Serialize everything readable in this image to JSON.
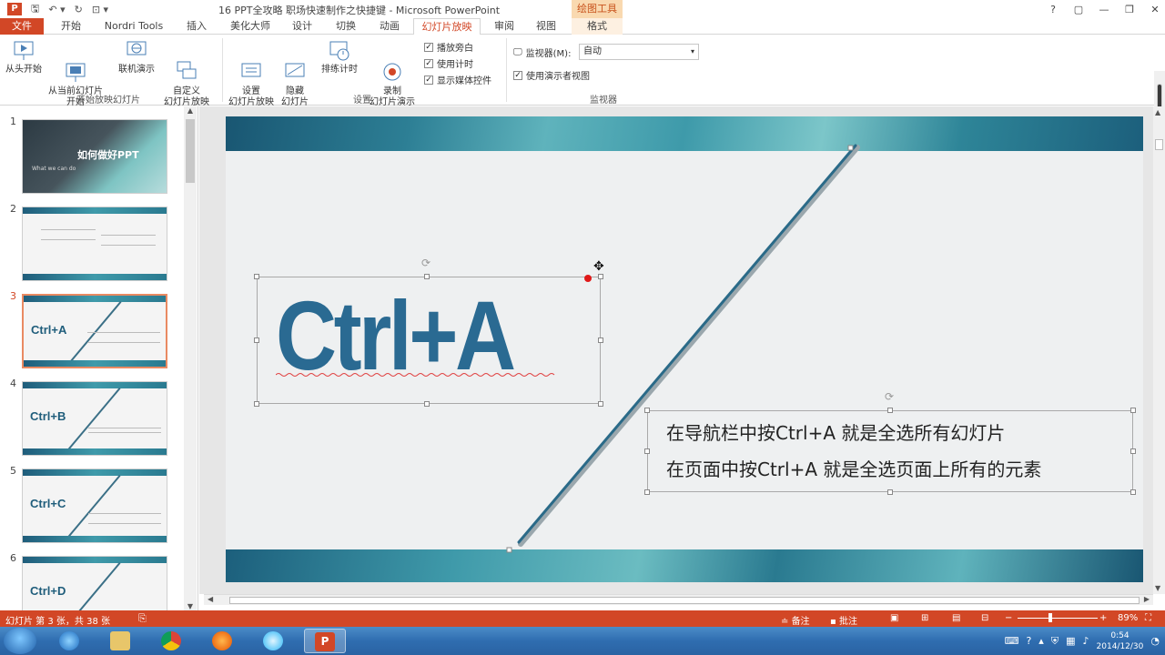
{
  "window": {
    "title": "16 PPT全攻略 职场快速制作之快捷键 - Microsoft PowerPoint",
    "contextual_tab_group": "绘图工具",
    "controls": [
      "?",
      "▢",
      "—",
      "❐",
      "✕"
    ]
  },
  "tabs": [
    {
      "label": "文件"
    },
    {
      "label": "开始"
    },
    {
      "label": "Nordri Tools"
    },
    {
      "label": "插入"
    },
    {
      "label": "美化大师"
    },
    {
      "label": "设计"
    },
    {
      "label": "切换"
    },
    {
      "label": "动画"
    },
    {
      "label": "幻灯片放映"
    },
    {
      "label": "审阅"
    },
    {
      "label": "视图"
    },
    {
      "label": "格式"
    }
  ],
  "ribbon": {
    "group1": {
      "label": "开始放映幻灯片",
      "buttons": [
        "从头开始",
        "从当前幻灯片\n开始",
        "联机演示",
        "自定义\n幻灯片放映"
      ]
    },
    "group2": {
      "label": "设置",
      "buttons": [
        "设置\n幻灯片放映",
        "隐藏\n幻灯片",
        "排练计时",
        "录制\n幻灯片演示"
      ],
      "checkboxes": [
        "播放旁白",
        "使用计时",
        "显示媒体控件"
      ]
    },
    "group3": {
      "label": "监视器",
      "monitor_label": "监视器(M):",
      "monitor_value": "自动",
      "presenter_view": "使用演示者视图"
    }
  },
  "thumbnails": [
    {
      "num": "1",
      "title": "如何做好PPT",
      "subtitle": "What we can do"
    },
    {
      "num": "2",
      "title": ""
    },
    {
      "num": "3",
      "title": "Ctrl+A"
    },
    {
      "num": "4",
      "title": "Ctrl+B"
    },
    {
      "num": "5",
      "title": "Ctrl+C"
    },
    {
      "num": "6",
      "title": "Ctrl+D"
    }
  ],
  "slide": {
    "heading": "Ctrl+A",
    "line1": "在导航栏中按Ctrl+A 就是全选所有幻灯片",
    "line2": "在页面中按Ctrl+A 就是全选页面上所有的元素"
  },
  "statusbar": {
    "slide_info": "幻灯片 第 3 张，共 38 张",
    "notes": "备注",
    "comments": "批注",
    "zoom": "89%"
  },
  "taskbar": {
    "time": "0:54",
    "date": "2014/12/30"
  }
}
